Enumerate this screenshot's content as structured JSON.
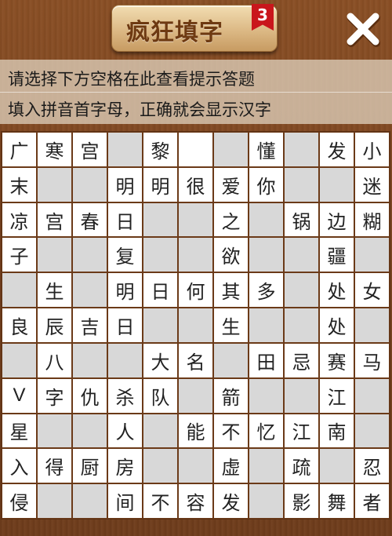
{
  "header": {
    "title": "疯狂填字",
    "level": "3",
    "close_icon": "close-icon"
  },
  "hint": {
    "line1": "请选择下方空格在此查看提示答题",
    "line2": "填入拼音首字母，正确就会显示汉字"
  },
  "colors": {
    "wood": "#7a4420",
    "cell_white": "#ffffff",
    "cell_gray": "#d8d8d8",
    "badge_red": "#c9161c"
  },
  "grid": {
    "rows": [
      [
        "广",
        "寒",
        "宫",
        "#",
        "黎",
        "",
        "#",
        "懂",
        "#",
        "发",
        "小"
      ],
      [
        "末",
        "#",
        "#",
        "明",
        "明",
        "很",
        "爱",
        "你",
        "#",
        "#",
        "迷"
      ],
      [
        "凉",
        "宫",
        "春",
        "日",
        "#",
        "#",
        "之",
        "#",
        "锅",
        "边",
        "糊"
      ],
      [
        "子",
        "#",
        "#",
        "复",
        "#",
        "#",
        "欲",
        "#",
        "#",
        "疆",
        "#"
      ],
      [
        "#",
        "生",
        "#",
        "明",
        "日",
        "何",
        "其",
        "多",
        "#",
        "处",
        "女"
      ],
      [
        "良",
        "辰",
        "吉",
        "日",
        "#",
        "#",
        "生",
        "#",
        "#",
        "处",
        "#"
      ],
      [
        "#",
        "八",
        "#",
        "#",
        "大",
        "名",
        "#",
        "田",
        "忌",
        "赛",
        "马"
      ],
      [
        "V",
        "字",
        "仇",
        "杀",
        "队",
        "#",
        "箭",
        "#",
        "#",
        "江",
        "#"
      ],
      [
        "星",
        "#",
        "#",
        "人",
        "#",
        "能",
        "不",
        "忆",
        "江",
        "南",
        "#"
      ],
      [
        "入",
        "得",
        "厨",
        "房",
        "#",
        "#",
        "虚",
        "#",
        "疏",
        "#",
        "忍"
      ],
      [
        "侵",
        "#",
        "#",
        "间",
        "不",
        "容",
        "发",
        "#",
        "影",
        "舞",
        "者"
      ]
    ]
  }
}
